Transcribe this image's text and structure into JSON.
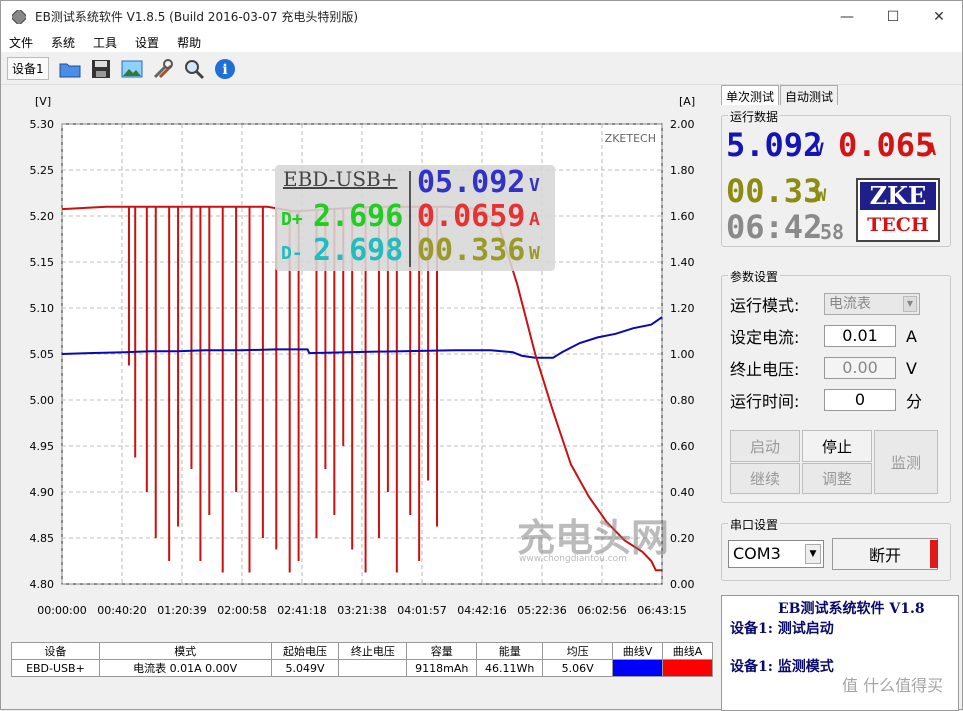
{
  "window": {
    "title": "EB测试系统软件 V1.8.5 (Build 2016-03-07 充电头特别版)",
    "minimize": "—",
    "maximize": "☐",
    "close": "✕"
  },
  "menu": [
    "文件",
    "系统",
    "工具",
    "设置",
    "帮助"
  ],
  "toolbar": {
    "device_label": "设备1",
    "icons": [
      "folder-icon",
      "save-icon",
      "image-icon",
      "tools-icon",
      "search-icon",
      "info-icon"
    ]
  },
  "overlay": {
    "model": "EBD-USB+",
    "voltage": "05.092",
    "voltage_unit": "V",
    "dplus_label": "D+",
    "dplus": "2.696",
    "current": "0.0659",
    "current_unit": "A",
    "dminus_label": "D-",
    "dminus": "2.698",
    "power": "00.336",
    "power_unit": "W"
  },
  "chart_watermark": "ZKETECH",
  "chart_data": {
    "type": "line",
    "y_left_label": "[V]",
    "y_right_label": "[A]",
    "y_left_ticks": [
      "5.30",
      "5.25",
      "5.20",
      "5.15",
      "5.10",
      "5.05",
      "5.00",
      "4.95",
      "4.90",
      "4.85",
      "4.80"
    ],
    "y_right_ticks": [
      "2.00",
      "1.80",
      "1.60",
      "1.40",
      "1.20",
      "1.00",
      "0.80",
      "0.60",
      "0.40",
      "0.20",
      "0.00"
    ],
    "x_ticks": [
      "00:00:00",
      "00:40:20",
      "01:20:39",
      "02:00:58",
      "02:41:18",
      "03:21:38",
      "04:01:57",
      "04:42:16",
      "05:22:36",
      "06:02:56",
      "06:43:15"
    ],
    "ylim_left": [
      4.8,
      5.3
    ],
    "ylim_right": [
      0.0,
      2.0
    ],
    "xlim_hours": [
      0,
      6.72
    ],
    "grid": true,
    "series": [
      {
        "color": "#0a0ab4",
        "axis": "left",
        "points": [
          [
            0,
            5.05
          ],
          [
            0.3,
            5.051
          ],
          [
            0.7,
            5.052
          ],
          [
            1.0,
            5.053
          ],
          [
            1.3,
            5.053
          ],
          [
            1.6,
            5.054
          ],
          [
            2.0,
            5.054
          ],
          [
            2.4,
            5.055
          ],
          [
            2.75,
            5.055
          ],
          [
            2.77,
            5.051
          ],
          [
            3.2,
            5.052
          ],
          [
            3.8,
            5.053
          ],
          [
            4.4,
            5.054
          ],
          [
            4.8,
            5.054
          ],
          [
            5.05,
            5.052
          ],
          [
            5.15,
            5.048
          ],
          [
            5.3,
            5.046
          ],
          [
            5.5,
            5.046
          ],
          [
            5.6,
            5.052
          ],
          [
            5.8,
            5.062
          ],
          [
            6.0,
            5.068
          ],
          [
            6.2,
            5.072
          ],
          [
            6.4,
            5.078
          ],
          [
            6.6,
            5.082
          ],
          [
            6.72,
            5.09
          ]
        ]
      },
      {
        "color": "#cc1010",
        "axis": "right",
        "points": [
          [
            0,
            1.63
          ],
          [
            0.5,
            1.64
          ],
          [
            1.5,
            1.64
          ],
          [
            2.3,
            1.64
          ],
          [
            2.6,
            1.62
          ],
          [
            3.0,
            1.63
          ],
          [
            3.5,
            1.64
          ],
          [
            4.3,
            1.64
          ],
          [
            4.7,
            1.63
          ],
          [
            4.9,
            1.55
          ],
          [
            5.1,
            1.3
          ],
          [
            5.3,
            1.0
          ],
          [
            5.5,
            0.75
          ],
          [
            5.7,
            0.52
          ],
          [
            5.9,
            0.38
          ],
          [
            6.1,
            0.27
          ],
          [
            6.3,
            0.19
          ],
          [
            6.5,
            0.14
          ],
          [
            6.6,
            0.1
          ],
          [
            6.65,
            0.06
          ],
          [
            6.72,
            0.06
          ]
        ]
      }
    ],
    "current_dips_hours": [
      0.75,
      0.82,
      0.95,
      1.05,
      1.2,
      1.3,
      1.45,
      1.55,
      1.65,
      1.8,
      1.95,
      2.1,
      2.25,
      2.4,
      2.55,
      2.65,
      2.85,
      2.95,
      3.05,
      3.15,
      3.25,
      3.4,
      3.55,
      3.65,
      3.75,
      3.9,
      4.0,
      4.1,
      4.2
    ],
    "current_dip_floor": [
      0.95,
      0.55,
      0.4,
      0.2,
      0.1,
      0.25,
      0.5,
      0.1,
      0.3,
      0.05,
      0.4,
      0.05,
      0.2,
      0.15,
      0.05,
      0.1,
      0.2,
      0.5,
      0.3,
      0.6,
      0.15,
      0.05,
      0.2,
      0.4,
      0.05,
      0.3,
      0.1,
      0.45,
      0.25
    ]
  },
  "right": {
    "tab_single": "单次测试",
    "tab_auto": "自动测试",
    "runtime_title": "运行数据",
    "voltage": "5.092",
    "voltage_unit": "V",
    "current": "0.065",
    "current_unit": "A",
    "power": "00.33",
    "power_unit": "W",
    "time": "06:42",
    "time_sec": "58",
    "logo_top": "ZKE",
    "logo_bottom": "TECH",
    "params_title": "参数设置",
    "mode_label": "运行模式:",
    "mode_value": "电流表",
    "set_current_label": "设定电流:",
    "set_current_value": "0.01",
    "set_current_unit": "A",
    "stop_voltage_label": "终止电压:",
    "stop_voltage_value": "0.00",
    "stop_voltage_unit": "V",
    "run_time_label": "运行时间:",
    "run_time_value": "0",
    "run_time_unit": "分",
    "btn_start": "启动",
    "btn_stop": "停止",
    "btn_monitor": "监测",
    "btn_continue": "继续",
    "btn_adjust": "调整",
    "serial_title": "串口设置",
    "com_value": "COM3",
    "btn_disconnect": "断开",
    "info_title": "EB测试系统软件 V1.8",
    "info_line1": "设备1: 测试启动",
    "info_line2": "设备1: 监测模式"
  },
  "table": {
    "headers": [
      "设备",
      "模式",
      "起始电压",
      "终止电压",
      "容量",
      "能量",
      "均压",
      "曲线V",
      "曲线A"
    ],
    "row": [
      "EBD-USB+",
      "电流表  0.01A  0.00V",
      "5.049V",
      "",
      "9118mAh",
      "46.11Wh",
      "5.06V"
    ],
    "curve_v_color": "#0000ff",
    "curve_a_color": "#ff0000"
  },
  "watermarks": {
    "brand": "充电头网",
    "site": "www.chongdiantou.com",
    "zhihu": "值 什么值得买"
  }
}
